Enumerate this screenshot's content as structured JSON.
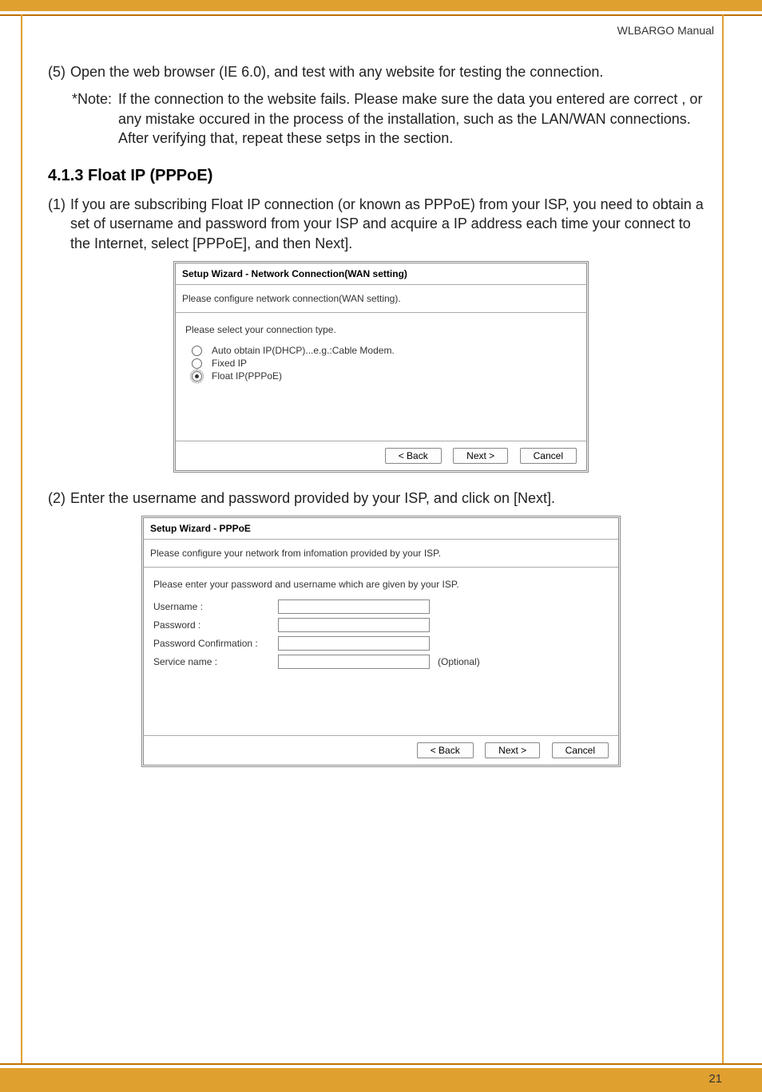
{
  "header": {
    "doc_title": "WLBARGO Manual"
  },
  "step5": {
    "num": "(5)",
    "text": "Open the web browser (IE 6.0), and test with any website for testing the connection."
  },
  "note": {
    "label": "*Note:",
    "text": "If the connection to the website fails. Please make sure the data you entered are correct , or any mistake occured in the process of the installation, such as the LAN/WAN connections. After verifying that, repeat these setps in the section."
  },
  "section_heading": "4.1.3 Float IP (PPPoE)",
  "step1": {
    "num": "(1)",
    "text": "If you are subscribing Float IP connection (or known as PPPoE) from your ISP, you need to obtain a set of username and password from your ISP and acquire a IP address each time your connect to the Internet, select [PPPoE], and then Next]."
  },
  "dialog1": {
    "title": "Setup Wizard - Network Connection(WAN setting)",
    "sub": "Please configure network connection(WAN setting).",
    "prompt": "Please select your connection type.",
    "options": [
      {
        "label": "Auto obtain IP(DHCP)...e.g.:Cable Modem.",
        "selected": false
      },
      {
        "label": "Fixed IP",
        "selected": false
      },
      {
        "label": "Float IP(PPPoE)",
        "selected": true
      }
    ],
    "buttons": {
      "back": "< Back",
      "next": "Next >",
      "cancel": "Cancel"
    }
  },
  "step2": {
    "num": "(2)",
    "text": "Enter the username and password provided by your ISP, and click on [Next]."
  },
  "dialog2": {
    "title": "Setup Wizard - PPPoE",
    "sub": "Please configure your network from infomation provided by your ISP.",
    "prompt": "Please enter your password and username which are given by your ISP.",
    "fields": {
      "username": "Username :",
      "password": "Password :",
      "password_confirm": "Password Confirmation :",
      "service": "Service name :",
      "optional": "(Optional)"
    },
    "buttons": {
      "back": "< Back",
      "next": "Next >",
      "cancel": "Cancel"
    }
  },
  "page_number": "21"
}
